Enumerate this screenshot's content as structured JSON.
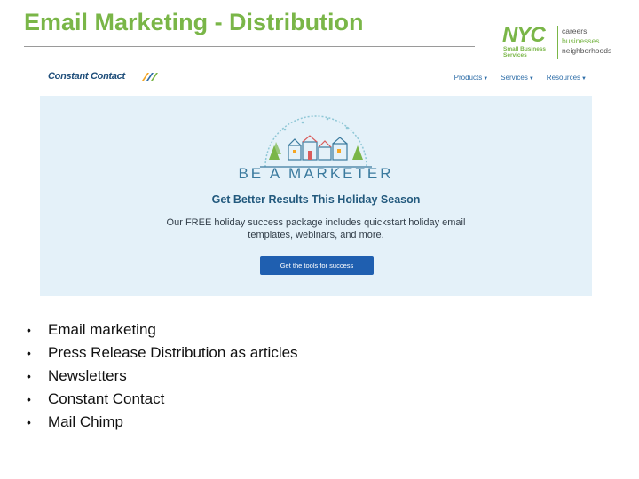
{
  "slide": {
    "title": "Email Marketing - Distribution"
  },
  "nyc_logo": {
    "mark": "NYC",
    "subtitle": "Small Business Services",
    "words": [
      "careers",
      "businesses",
      "neighborhoods"
    ]
  },
  "embedded_screenshot": {
    "logo_text": "Constant Contact",
    "nav": [
      {
        "label": "Products"
      },
      {
        "label": "Services"
      },
      {
        "label": "Resources"
      }
    ],
    "hero_title": "BE A MARKETER",
    "headline": "Get Better Results This Holiday Season",
    "body": "Our FREE holiday success package includes quickstart holiday email templates, webinars, and more.",
    "cta": "Get the tools for success"
  },
  "bullets": [
    "Email marketing",
    "Press Release Distribution as articles",
    "Newsletters",
    "Constant Contact",
    "Mail Chimp"
  ],
  "colors": {
    "title_green": "#7ab648",
    "hero_bg": "#e4f1f9",
    "cta_blue": "#1f5fb0",
    "link_blue": "#2f6ea8"
  }
}
